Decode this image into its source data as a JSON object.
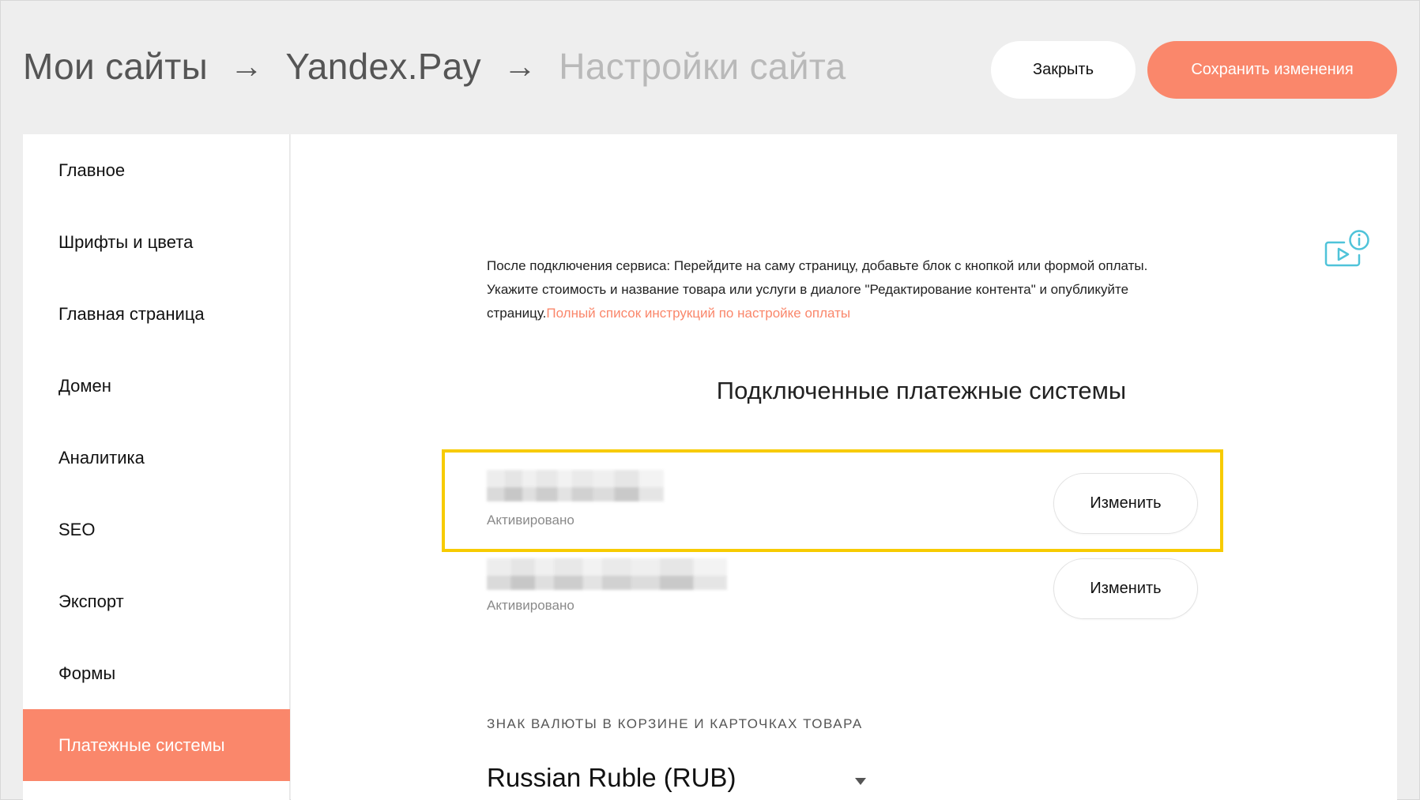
{
  "header": {
    "breadcrumb": [
      {
        "label": "Мои сайты"
      },
      {
        "label": "Yandex.Pay"
      },
      {
        "label": "Настройки сайта"
      }
    ],
    "separator": "→",
    "close_label": "Закрыть",
    "save_label": "Сохранить изменения"
  },
  "sidebar": {
    "items": [
      {
        "label": "Главное"
      },
      {
        "label": "Шрифты и цвета"
      },
      {
        "label": "Главная страница"
      },
      {
        "label": "Домен"
      },
      {
        "label": "Аналитика"
      },
      {
        "label": "SEO"
      },
      {
        "label": "Экспорт"
      },
      {
        "label": "Формы"
      },
      {
        "label": "Платежные системы",
        "active": true
      }
    ]
  },
  "main": {
    "intro_text": "После подключения сервиса: Перейдите на саму страницу, добавьте блок с кнопкой или формой оплаты. Укажите стоимость и название товара или услуги в диалоге \"Редактирование контента\" и опубликуйте страницу.",
    "intro_link": "Полный список инструкций по настройке оплаты",
    "section_title": "Подключенные платежные системы",
    "payment_systems": [
      {
        "status": "Активировано",
        "edit_label": "Изменить",
        "highlighted": true
      },
      {
        "status": "Активировано",
        "edit_label": "Изменить",
        "highlighted": false
      }
    ],
    "currency_label": "ЗНАК ВАЛЮТЫ В КОРЗИНЕ И КАРТОЧКАХ ТОВАРА",
    "currency_value": "Russian Ruble (RUB)",
    "icons": {
      "video_info": "video-info-icon",
      "dropdown": "chevron-down-icon"
    },
    "colors": {
      "accent": "#fa876b",
      "highlight": "#f7cb00",
      "icon": "#4fc3d9"
    }
  }
}
